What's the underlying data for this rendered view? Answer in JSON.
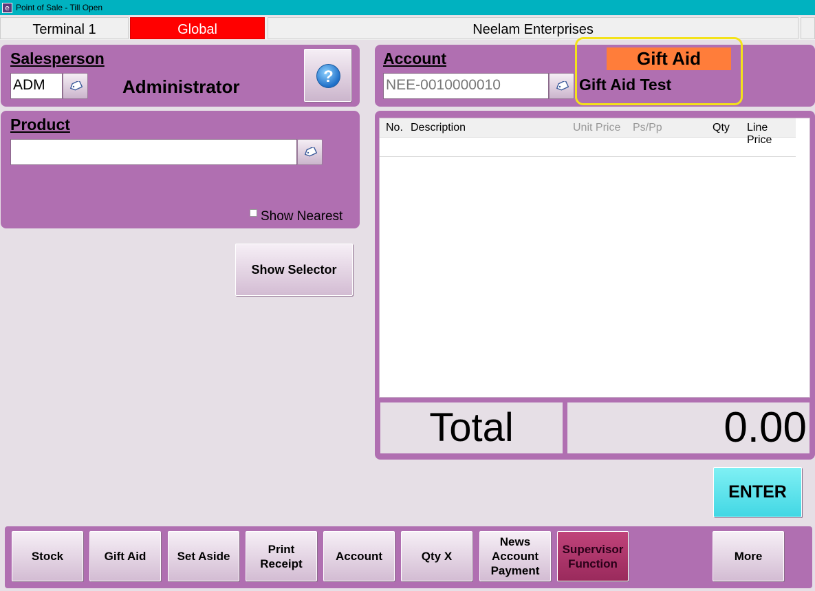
{
  "window": {
    "title": "Point of Sale - Till Open",
    "icon": "e"
  },
  "infobar": {
    "terminal": "Terminal 1",
    "mode": "Global",
    "company": "Neelam Enterprises"
  },
  "salesperson": {
    "label": "Salesperson",
    "code": "ADM",
    "name": "Administrator",
    "lookup_icon": "tag-icon"
  },
  "help": {
    "icon": "help-icon",
    "glyph": "?"
  },
  "product": {
    "label": "Product",
    "value": "",
    "show_nearest_label": "Show Nearest",
    "show_nearest_checked": false
  },
  "show_selector_label": "Show Selector",
  "account": {
    "label": "Account",
    "code": "NEE-0010000010",
    "gift_aid_badge": "Gift Aid",
    "name": "Gift Aid Test"
  },
  "list": {
    "columns": {
      "no": "No.",
      "description": "Description",
      "unit_price": "Unit Price",
      "pspp": "Ps/Pp",
      "qty": "Qty",
      "line_price": "Line Price"
    },
    "rows": []
  },
  "total": {
    "label": "Total",
    "value": "0.00"
  },
  "enter_label": "ENTER",
  "footer": {
    "stock": "Stock",
    "gift_aid": "Gift Aid",
    "set_aside": "Set Aside",
    "print_receipt": "Print\nReceipt",
    "account": "Account",
    "qty_x": "Qty X",
    "news_account_payment": "News\nAccount\nPayment",
    "supervisor_function": "Supervisor\nFunction",
    "more": "More"
  },
  "colors": {
    "titlebar": "#00b2c0",
    "panel": "#b06fb1",
    "global_badge": "#ff0000",
    "gift_aid_badge": "#ff7d3a",
    "highlight_outline": "#f3e21a",
    "enter_button": "#42d7e4",
    "supervisor_button": "#9a2a5c"
  }
}
